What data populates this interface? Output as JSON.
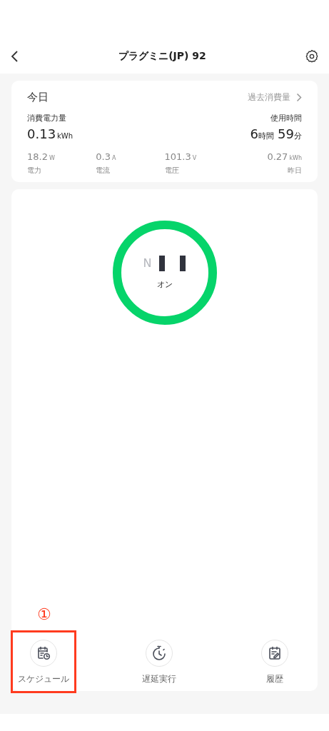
{
  "header": {
    "title": "プラグミニ(JP) 92"
  },
  "today": {
    "title": "今日",
    "history_link": "過去消費量",
    "energy": {
      "label": "消費電力量",
      "value": "0.13",
      "unit": "kWh"
    },
    "usage": {
      "label": "使用時間",
      "hours": "6",
      "hours_unit": "時間",
      "minutes": "59",
      "minutes_unit": "分"
    },
    "stats": [
      {
        "value": "18.2",
        "unit": "W",
        "label": "電力"
      },
      {
        "value": "0.3",
        "unit": "A",
        "label": "電流"
      },
      {
        "value": "101.3",
        "unit": "V",
        "label": "電圧"
      },
      {
        "value": "0.27",
        "unit": "kWh",
        "label": "昨日"
      }
    ]
  },
  "power": {
    "on": true,
    "pole_mark": "N",
    "status": "オン"
  },
  "actions": [
    {
      "kind": "schedule",
      "label": "スケジュール",
      "highlighted": true
    },
    {
      "kind": "timer",
      "label": "遅延実行",
      "highlighted": false
    },
    {
      "kind": "history",
      "label": "履歴",
      "highlighted": false
    }
  ],
  "annotation": {
    "mark": "①"
  }
}
